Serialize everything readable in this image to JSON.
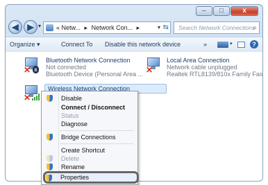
{
  "breadcrumb": {
    "part1": "« Netw...",
    "part2": "Network Con...",
    "sep": "▸"
  },
  "search": {
    "placeholder": "Search Network Connections"
  },
  "toolbar": {
    "organize": "Organize",
    "connect_to": "Connect To",
    "disable_device": "Disable this network device",
    "more": "»"
  },
  "connections": [
    {
      "name": "Bluetooth Network Connection",
      "status": "Not connected",
      "device": "Bluetooth Device (Personal Area ..."
    },
    {
      "name": "Local Area Connection",
      "status": "Network cable unplugged",
      "device": "Realtek RTL8139/810x Family Fast..."
    },
    {
      "name": "Wireless Network Connection"
    }
  ],
  "context_menu": {
    "disable": "Disable",
    "connect": "Connect / Disconnect",
    "status": "Status",
    "diagnose": "Diagnose",
    "bridge": "Bridge Connections",
    "shortcut": "Create Shortcut",
    "delete": "Delete",
    "rename": "Rename",
    "properties": "Properties"
  },
  "icons": {
    "back": "back-arrow-icon",
    "forward": "forward-arrow-icon",
    "refresh": "refresh-icon",
    "search": "magnifier-icon",
    "view": "view-icon",
    "preview": "preview-pane-icon",
    "help": "help-icon",
    "shield": "uac-shield-icon"
  },
  "colors": {
    "accent": "#3a6fc8",
    "error": "#d62b16",
    "highlight": "#666666"
  }
}
